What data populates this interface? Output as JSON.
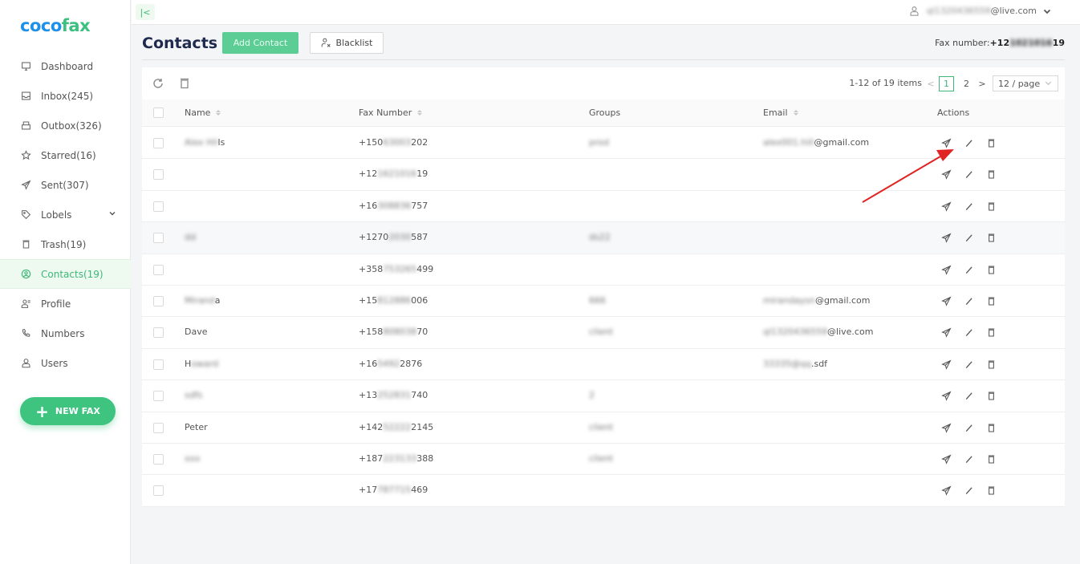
{
  "app": {
    "logo_part1": "coco",
    "logo_part2": "fax",
    "brand_colors": {
      "blue": "#1e90e8",
      "green": "#3cc07f"
    }
  },
  "sidebar": {
    "items": [
      {
        "label": "Dashboard",
        "icon": "monitor-icon"
      },
      {
        "label": "Inbox(245)",
        "icon": "inbox-icon"
      },
      {
        "label": "Outbox(326)",
        "icon": "outbox-icon"
      },
      {
        "label": "Starred(16)",
        "icon": "star-icon"
      },
      {
        "label": "Sent(307)",
        "icon": "send-icon"
      },
      {
        "label": "Lobels",
        "icon": "tag-icon",
        "expandable": true
      },
      {
        "label": "Trash(19)",
        "icon": "trash-icon"
      },
      {
        "label": "Contacts(19)",
        "icon": "contact-icon",
        "active": true
      },
      {
        "label": "Profile",
        "icon": "profile-icon"
      },
      {
        "label": "Numbers",
        "icon": "phone-icon"
      },
      {
        "label": "Users",
        "icon": "user-icon"
      }
    ],
    "new_fax_label": "NEW FAX"
  },
  "topbar": {
    "collapse_icon": "|<",
    "user_email_hidden": "ql1320436559",
    "user_email_domain": "@live.com"
  },
  "header": {
    "title": "Contacts",
    "add_contact_label": "Add Contact",
    "blacklist_label": "Blacklist",
    "fax_label": "Fax number:",
    "fax_prefix": "+12",
    "fax_hidden": "1021016",
    "fax_suffix": "19"
  },
  "table": {
    "pager_info": "1-12 of 19 items",
    "pages": [
      "1",
      "2"
    ],
    "current_page": "1",
    "prev": "<",
    "next": ">",
    "page_size": "12 / page",
    "columns": {
      "name": "Name",
      "fax": "Fax Number",
      "groups": "Groups",
      "email": "Email",
      "actions": "Actions"
    },
    "rows": [
      {
        "name_hidden": "Alex Hil",
        "name_visible": "ls",
        "fax_pre": "+150",
        "fax_hidden": "63003",
        "fax_post": "202",
        "group": "prod",
        "email_hidden": "alex001.hill",
        "email_domain": "@gmail.com"
      },
      {
        "name_hidden": "",
        "name_visible": "",
        "fax_pre": "+12",
        "fax_hidden": "1621016",
        "fax_post": "19",
        "group": "",
        "email_hidden": "",
        "email_domain": ""
      },
      {
        "name_hidden": "",
        "name_visible": "",
        "fax_pre": "+16",
        "fax_hidden": "308836",
        "fax_post": "757",
        "group": "",
        "email_hidden": "",
        "email_domain": ""
      },
      {
        "name_hidden": "dd",
        "name_visible": "",
        "fax_pre": "+1270",
        "fax_hidden": "2030",
        "fax_post": "587",
        "group": "ds22",
        "email_hidden": "",
        "email_domain": ""
      },
      {
        "name_hidden": "",
        "name_visible": "",
        "fax_pre": "+358",
        "fax_hidden": "753265",
        "fax_post": "499",
        "group": "",
        "email_hidden": "",
        "email_domain": ""
      },
      {
        "name_hidden": "Mirand",
        "name_visible": "a",
        "fax_pre": "+15",
        "fax_hidden": "812886",
        "fax_post": "006",
        "group": "666",
        "email_hidden": "mirandaysn",
        "email_domain": "@gmail.com"
      },
      {
        "name_hidden": "",
        "name_visible": "Dave",
        "fax_pre": "+158",
        "fax_hidden": "808038",
        "fax_post": "70",
        "group": "client",
        "email_hidden": "ql1320436559",
        "email_domain": "@live.com"
      },
      {
        "name_hidden": "oward",
        "name_visible": "H",
        "fax_pre": "+16",
        "fax_hidden": "5492",
        "fax_post": "2876",
        "group": "",
        "email_hidden": "33335@qq",
        "email_domain": ".sdf"
      },
      {
        "name_hidden": "sdfs",
        "name_visible": "",
        "fax_pre": "+13",
        "fax_hidden": "252831",
        "fax_post": "740",
        "group": "2",
        "email_hidden": "",
        "email_domain": ""
      },
      {
        "name_hidden": "",
        "name_visible": "Peter",
        "fax_pre": "+142",
        "fax_hidden": "52222",
        "fax_post": "2145",
        "group": "client",
        "email_hidden": "",
        "email_domain": ""
      },
      {
        "name_hidden": "xxx",
        "name_visible": "",
        "fax_pre": "+187",
        "fax_hidden": "223133",
        "fax_post": "388",
        "group": "client",
        "email_hidden": "",
        "email_domain": ""
      },
      {
        "name_hidden": "",
        "name_visible": "",
        "fax_pre": "+17",
        "fax_hidden": "787715",
        "fax_post": "469",
        "group": "",
        "email_hidden": "",
        "email_domain": ""
      }
    ],
    "row_actions": [
      "send-fax",
      "edit",
      "delete"
    ]
  },
  "annotation": {
    "arrow_color": "#e02424",
    "points_to": "send-fax action of first row"
  }
}
